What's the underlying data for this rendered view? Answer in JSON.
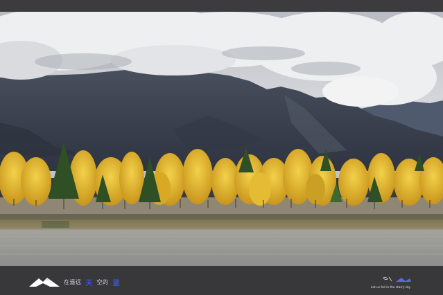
{
  "footer": {
    "slogan_part1": "在遥远",
    "slogan_part2": "天",
    "slogan_part3": "空的",
    "slogan_part4": "蓝",
    "signature_text": "Let us fall in the starry sky"
  },
  "colors": {
    "frame": "#3a3a3c",
    "sky": "#c9ccd2",
    "mountain": "#3d4452",
    "foliage": "#e0b42a",
    "conifer": "#355a2a",
    "water": "#9a9a98",
    "accent_blue": "#3a55d8"
  },
  "icons": {
    "left_logo": "mountain-logo-icon",
    "right_logo": "signature-logo-icon"
  }
}
